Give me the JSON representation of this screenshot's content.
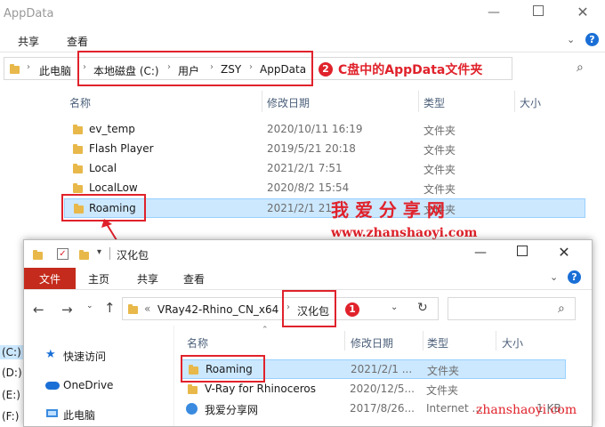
{
  "window1": {
    "title": "AppData",
    "ribbon_tabs": [
      "共享",
      "查看"
    ],
    "breadcrumb": [
      "此电脑",
      "本地磁盘 (C:)",
      "用户",
      "ZSY",
      "AppData"
    ],
    "annotation_num": "2",
    "annotation_text": "C盘中的AppData文件夹",
    "columns": {
      "name": "名称",
      "date": "修改日期",
      "type": "类型",
      "size": "大小"
    },
    "rows": [
      {
        "name": "ev_temp",
        "date": "2020/10/11 16:19",
        "type": "文件夹"
      },
      {
        "name": "Flash Player",
        "date": "2019/5/21 20:18",
        "type": "文件夹"
      },
      {
        "name": "Local",
        "date": "2021/2/1 7:51",
        "type": "文件夹"
      },
      {
        "name": "LocalLow",
        "date": "2020/8/2 15:54",
        "type": "文件夹"
      },
      {
        "name": "Roaming",
        "date": "2021/2/1 21",
        "type": "文件夹"
      }
    ]
  },
  "watermark": {
    "title": "我 爱 分 享 网",
    "url": "www.zhanshaoyi.com",
    "corner": "zhanshaoyi.com"
  },
  "window2": {
    "title": "汉化包",
    "ribbon_tabs": [
      "文件",
      "主页",
      "共享",
      "查看"
    ],
    "breadcrumb": [
      "«",
      "VRay42-Rhino_CN_x64",
      "汉化包"
    ],
    "annotation_num": "1",
    "columns": {
      "name": "名称",
      "date": "修改日期",
      "type": "类型",
      "size": "大小"
    },
    "quick_access": [
      "快速访问",
      "OneDrive",
      "此电脑"
    ],
    "rows": [
      {
        "name": "Roaming",
        "date": "2021/2/1 ...",
        "type": "文件夹",
        "size": ""
      },
      {
        "name": "V-Ray for Rhinoceros",
        "date": "2020/12/5...",
        "type": "文件夹",
        "size": ""
      },
      {
        "name": "我爱分享网",
        "date": "2017/8/26...",
        "type": "Internet ...",
        "size": "1 KB"
      }
    ]
  },
  "left_drives": [
    "(C:)",
    "(D:)",
    "(E:)",
    "(F:)"
  ],
  "colors": {
    "accent_red": "#e0222b",
    "file_tab": "#c42b1c",
    "selection": "#cce8ff",
    "folder": "#e8b84a"
  }
}
